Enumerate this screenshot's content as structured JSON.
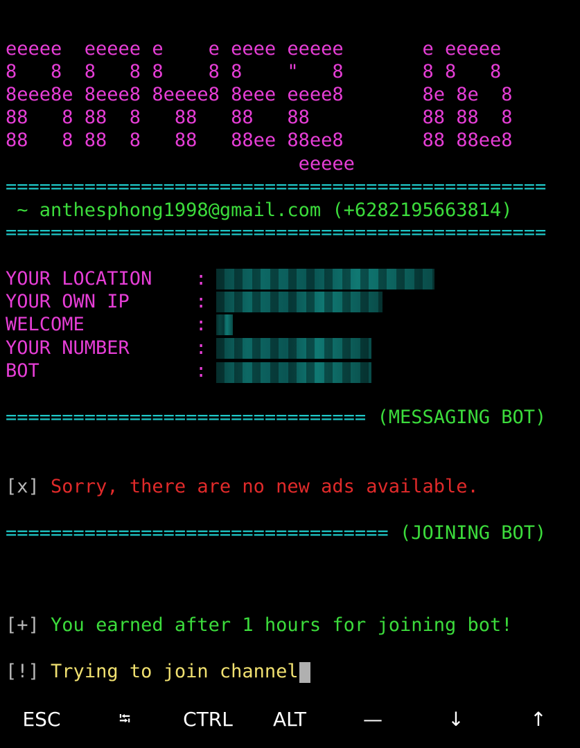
{
  "banner": {
    "lines": [
      "eeeee  eeeee e    e eeee eeeee       e eeeee",
      "8   8  8   8 8    8 8    \"   8       8 8   8",
      "8eee8e 8eee8 8eeee8 8eee eeee8       8e 8e  8",
      "88   8 88  8   88   88   88          88 88  8",
      "88   8 88  8   88   88ee 88ee8       88 88ee8",
      "                          eeeee"
    ]
  },
  "separator": "================================================",
  "contact": " ~ anthesphong1998@gmail.com (+6282195663814)",
  "info": {
    "rows": [
      {
        "label": "YOUR LOCATION",
        "colon": ":"
      },
      {
        "label": "YOUR OWN IP",
        "colon": ":"
      },
      {
        "label": "WELCOME",
        "colon": ":"
      },
      {
        "label": "YOUR NUMBER",
        "colon": ":"
      },
      {
        "label": "BOT",
        "colon": ":"
      }
    ]
  },
  "messaging": {
    "separator": "================================",
    "title": "(MESSAGING BOT)",
    "status_prefix": "[x]",
    "status_text": "Sorry, there are no new ads available."
  },
  "joining": {
    "separator": "==================================",
    "title": "(JOINING BOT)",
    "earned_prefix": "[+]",
    "earned_text": "You earned after 1 hours for joining bot!",
    "trying_prefix": "[!]",
    "trying_text": "Trying to join channel"
  },
  "keys": {
    "esc": "ESC",
    "tab": "⭾",
    "ctrl": "CTRL",
    "alt": "ALT",
    "dash": "—",
    "down": "↓",
    "up": "↑"
  },
  "colors": {
    "magenta": "#e63ed6",
    "cyan": "#1fc8c8",
    "green": "#3cdc3c",
    "red": "#e02a2a",
    "yellow": "#f0e070",
    "background": "#000000"
  }
}
